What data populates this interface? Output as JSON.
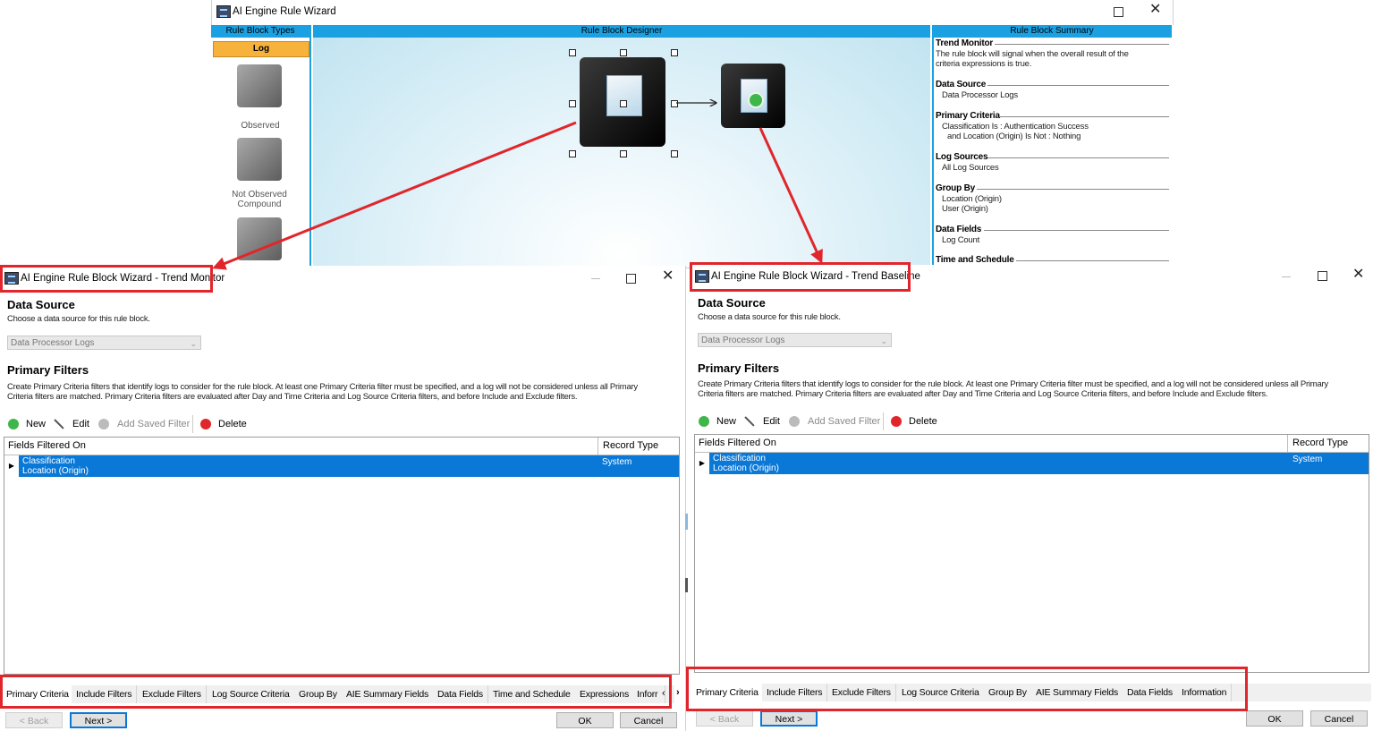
{
  "top_wizard": {
    "title": "AI Engine Rule Wizard",
    "rule_block_types": {
      "header": "Rule Block Types",
      "category": "Log",
      "items": [
        "Observed",
        "Not Observed Compound"
      ]
    },
    "designer": {
      "header": "Rule Block Designer"
    },
    "summary": {
      "header": "Rule Block Summary",
      "sections": [
        {
          "title": "Trend Monitor",
          "lines": [
            "The rule block will signal when the overall result of the",
            "criteria expressions is true."
          ]
        },
        {
          "title": "Data Source",
          "lines": [
            "Data Processor Logs"
          ]
        },
        {
          "title": "Primary Criteria",
          "lines": [
            "Classification Is :  Authentication Success",
            "and Location (Origin) Is Not :  Nothing"
          ]
        },
        {
          "title": "Log Sources",
          "lines": [
            "All Log Sources"
          ]
        },
        {
          "title": "Group By",
          "lines": [
            "Location (Origin)",
            "User (Origin)"
          ]
        },
        {
          "title": "Data Fields",
          "lines": [
            "Log Count"
          ]
        },
        {
          "title": "Time and Schedule",
          "lines": []
        }
      ]
    }
  },
  "dialogs": [
    {
      "title": "AI Engine Rule Block Wizard - Trend Monitor",
      "data_source_title": "Data Source",
      "data_source_desc": "Choose a data source for this rule block.",
      "data_source_value": "Data Processor Logs",
      "primary_title": "Primary Filters",
      "primary_desc_1": "Create Primary Criteria filters that identify logs to consider for the rule block. At least one Primary Criteria filter must be specified, and a log will not be considered unless all Primary",
      "primary_desc_2": "Criteria filters are matched. Primary Criteria filters are evaluated after Day and Time Criteria and Log Source Criteria filters, and before Include and Exclude filters.",
      "toolbar": {
        "new": "New",
        "edit": "Edit",
        "add_saved": "Add Saved Filter",
        "delete": "Delete"
      },
      "grid": {
        "col_fields": "Fields Filtered On",
        "col_record": "Record Type",
        "rows": [
          {
            "field_1": "Classification",
            "field_2": "Location (Origin)",
            "record": "System"
          }
        ]
      },
      "tabs": [
        "Primary Criteria",
        "Include Filters",
        "Exclude Filters",
        "Log Source Criteria",
        "Group By",
        "AIE Summary Fields",
        "Data Fields",
        "Time and Schedule",
        "Expressions",
        "Inforr"
      ],
      "buttons": {
        "back": "< Back",
        "next": "Next >",
        "ok": "OK",
        "cancel": "Cancel"
      }
    },
    {
      "title": "AI Engine Rule Block Wizard - Trend Baseline",
      "data_source_title": "Data Source",
      "data_source_desc": "Choose a data source for this rule block.",
      "data_source_value": "Data Processor Logs",
      "primary_title": "Primary Filters",
      "primary_desc_1": "Create Primary Criteria filters that identify logs to consider for the rule block. At least one Primary Criteria filter must be specified, and a log will not be considered unless all Primary",
      "primary_desc_2": "Criteria filters are matched. Primary Criteria filters are evaluated after Day and Time Criteria and Log Source Criteria filters, and before Include and Exclude filters.",
      "toolbar": {
        "new": "New",
        "edit": "Edit",
        "add_saved": "Add Saved Filter",
        "delete": "Delete"
      },
      "grid": {
        "col_fields": "Fields Filtered On",
        "col_record": "Record Type",
        "rows": [
          {
            "field_1": "Classification",
            "field_2": "Location (Origin)",
            "record": "System"
          }
        ]
      },
      "tabs": [
        "Primary Criteria",
        "Include Filters",
        "Exclude Filters",
        "Log Source Criteria",
        "Group By",
        "AIE Summary Fields",
        "Data Fields",
        "Information"
      ],
      "buttons": {
        "back": "< Back",
        "next": "Next >",
        "ok": "OK",
        "cancel": "Cancel"
      }
    }
  ],
  "colors": {
    "selection": "#0a78d7",
    "annotation": "#e0262b",
    "log_header": "#f7b23b",
    "panel_header": "#1ba1e2"
  }
}
